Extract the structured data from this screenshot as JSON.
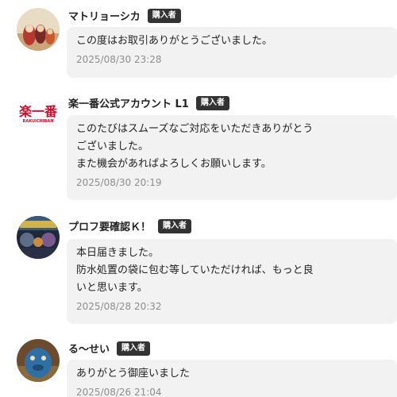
{
  "comments": [
    {
      "name": "マトリョーシカ",
      "badge": "購入者",
      "lines": [
        "この度はお取引ありがとうございました。"
      ],
      "timestamp": "2025/08/30 23:28"
    },
    {
      "name": "楽一番公式アカウント L1",
      "badge": "購入者",
      "logo_text_top": "楽一番",
      "logo_text_bottom": "RAKUICHIBAN",
      "lines": [
        "このたびはスムーズなご対応をいただきありがとう",
        "ございました。",
        "また機会があればよろしくお願いします。"
      ],
      "timestamp": "2025/08/30 20:19"
    },
    {
      "name": "プロフ要確認Ｋ！",
      "badge": "購入者",
      "lines": [
        "本日届きました。",
        "防水処置の袋に包む等していただければ、もっと良",
        "いと思います。"
      ],
      "timestamp": "2025/08/28 20:32"
    },
    {
      "name": "る〜せい",
      "badge": "購入者",
      "lines": [
        "ありがとう御座いました"
      ],
      "timestamp": "2025/08/26 21:04"
    }
  ],
  "colors": {
    "badge_bg": "#333333",
    "bubble_bg": "#f2f2f2",
    "timestamp": "#8e8e8e",
    "logo_red": "#c8102e"
  }
}
